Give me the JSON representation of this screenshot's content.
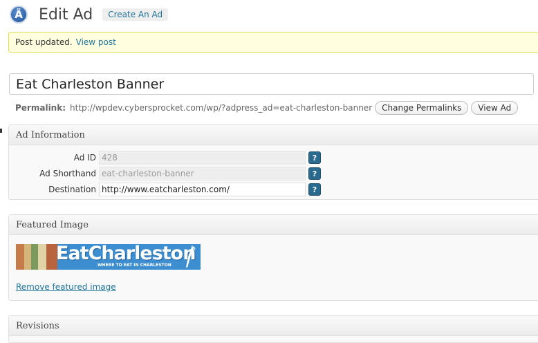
{
  "header": {
    "logo_letter": "Ä",
    "title": "Edit Ad",
    "create_label": "Create An Ad"
  },
  "notice": {
    "text": "Post updated.",
    "link": "View post"
  },
  "post_title": "Eat Charleston Banner",
  "permalink": {
    "label": "Permalink:",
    "url": "http://wpdev.cybersprocket.com/wp/?adpress_ad=eat-charleston-banner",
    "change_label": "Change Permalinks",
    "view_label": "View Ad"
  },
  "ad_info": {
    "heading": "Ad Information",
    "fields": [
      {
        "label": "Ad ID",
        "value": "428",
        "help": "?"
      },
      {
        "label": "Ad Shorthand",
        "value": "eat-charleston-banner",
        "help": "?"
      },
      {
        "label": "Destination",
        "value": "http://www.eatcharleston.com/",
        "help": "?"
      }
    ]
  },
  "featured": {
    "heading": "Featured Image",
    "banner_brand": "EatCharleston",
    "banner_sub": "WHERE TO EAT IN CHARLESTON",
    "remove_label": "Remove featured image"
  },
  "revisions": {
    "heading": "Revisions"
  }
}
